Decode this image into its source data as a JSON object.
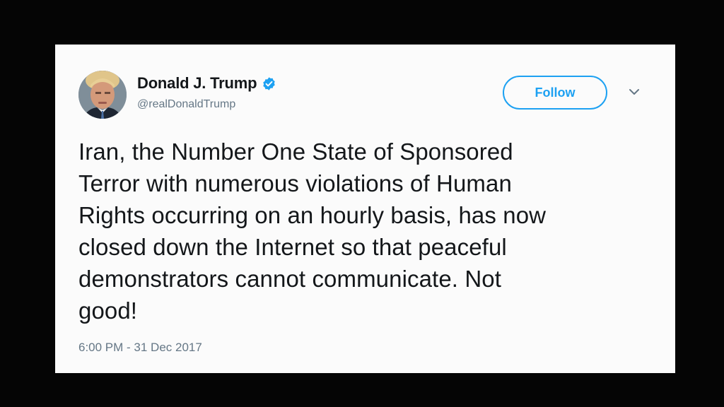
{
  "tweet": {
    "author": {
      "display_name": "Donald J. Trump",
      "handle": "@realDonaldTrump",
      "verified": true,
      "avatar_icon": "profile-photo"
    },
    "follow_label": "Follow",
    "menu_icon": "chevron-down-icon",
    "text_lines": [
      "Iran, the Number One State of Sponsored",
      "Terror with numerous violations of Human",
      "Rights occurring on an hourly basis, has now",
      "closed down the Internet so that peaceful",
      "demonstrators cannot communicate. Not",
      "good!"
    ],
    "timestamp": "6:00 PM - 31 Dec 2017"
  },
  "colors": {
    "accent": "#1da1f2",
    "text": "#14171a",
    "secondary_text": "#657786",
    "card_background": "#fbfbfb",
    "frame_background": "#000000"
  }
}
